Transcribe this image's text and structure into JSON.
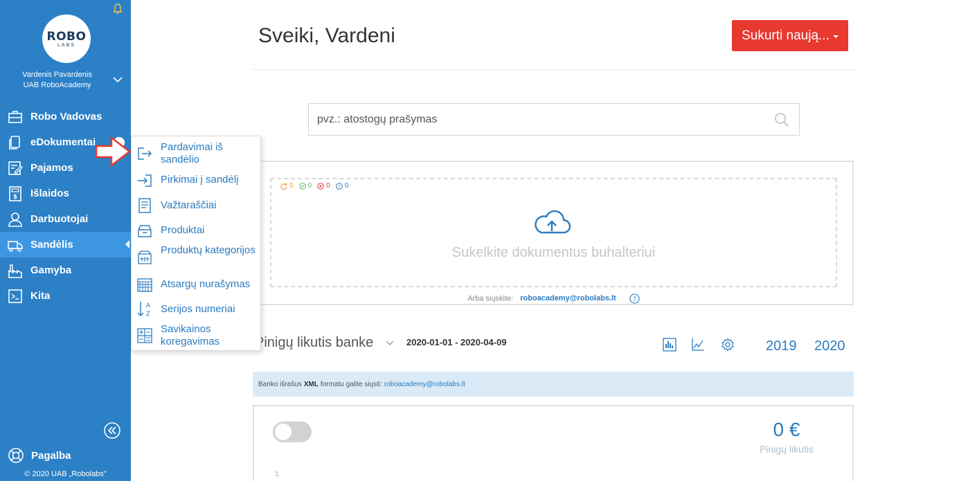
{
  "sidebar": {
    "logo_line1": "ROBO",
    "logo_line2": "LABS",
    "user_name": "Vardenis Pavardenis",
    "company": "UAB RoboAcademy",
    "items": [
      {
        "label": "Robo Vadovas",
        "icon": "briefcase-icon"
      },
      {
        "label": "eDokumentai",
        "icon": "documents-icon"
      },
      {
        "label": "Pajamos",
        "icon": "income-edit-icon"
      },
      {
        "label": "Išlaidos",
        "icon": "receipt-icon"
      },
      {
        "label": "Darbuotojai",
        "icon": "employee-icon"
      },
      {
        "label": "Sandėlis",
        "icon": "warehouse-truck-icon",
        "active": true
      },
      {
        "label": "Gamyba",
        "icon": "factory-icon"
      },
      {
        "label": "Kita",
        "icon": "other-icon"
      }
    ],
    "help": "Pagalba",
    "copyright": "© 2020 UAB „Robolabs\""
  },
  "submenu": {
    "items": [
      {
        "label": "Pardavimai iš sandėlio",
        "icon": "sign-out-icon"
      },
      {
        "label": "Pirkimai į sandėlį",
        "icon": "sign-in-icon"
      },
      {
        "label": "Važtaraščiai",
        "icon": "waybill-icon"
      },
      {
        "label": "Produktai",
        "icon": "inbox-icon"
      },
      {
        "label": "Produktų kategorijos",
        "icon": "category-icon"
      },
      {
        "label": "Atsargų nurašymas",
        "icon": "write-off-icon"
      },
      {
        "label": "Serijos numeriai",
        "icon": "sort-az-icon"
      },
      {
        "label": "Savikainos koregavimas",
        "icon": "calculator-icon"
      }
    ]
  },
  "header": {
    "greeting": "Sveiki, Vardeni",
    "create_button": "Sukurti naują..."
  },
  "search": {
    "placeholder": "pvz.: atostogų prašymas"
  },
  "upload": {
    "counts": [
      "0",
      "0",
      "0",
      "0"
    ],
    "title": "Sukelkite dokumentus buhalteriui",
    "email_prefix": "Arba siųskite:",
    "email": "roboacademy@robolabs.lt"
  },
  "bank": {
    "title": "Pinigų likutis banke",
    "date_range": "2020-01-01 - 2020-04-09",
    "years": [
      "2019",
      "2020"
    ],
    "info_prefix": "Banko išrašus",
    "info_format": "XML",
    "info_suffix": "formatu galite siųsti:",
    "info_email": "roboacademy@robolabs.lt",
    "balance_value": "0 €",
    "balance_label": "Pinigų likutis",
    "chart_tick": "1"
  },
  "colors": {
    "sidebar": "#2c80c6",
    "sidebar_active": "#3e97e2",
    "accent_red": "#e8392f",
    "link_blue": "#2a7bbf"
  }
}
